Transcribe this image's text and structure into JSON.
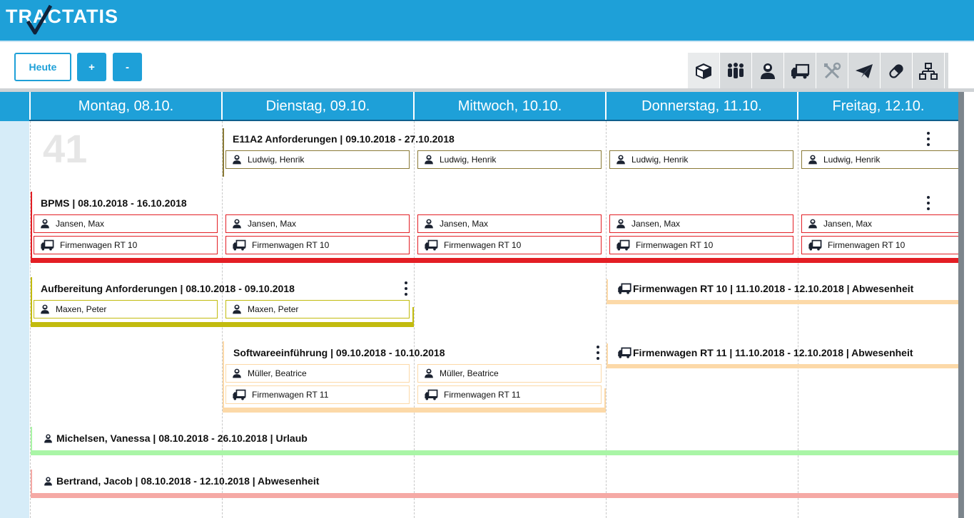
{
  "app": {
    "brand": "TRACTATIS"
  },
  "toolbar": {
    "today_label": "Heute",
    "zoom_in_label": "+",
    "zoom_out_label": "-"
  },
  "filter_icons": [
    "package-icon",
    "team-icon",
    "person-icon",
    "truck-icon",
    "tools-icon",
    "paper-plane-icon",
    "pill-icon",
    "hierarchy-icon"
  ],
  "calendar": {
    "week_number": "41",
    "days": [
      "Montag, 08.10.",
      "Dienstag, 09.10.",
      "Mittwoch, 10.10.",
      "Donnerstag, 11.10.",
      "Freitag, 12.10."
    ]
  },
  "events": {
    "e11a2": {
      "title": "E11A2 Anforderungen  | 09.10.2018 - 27.10.2018",
      "person": "Ludwig, Henrik",
      "color": "#8a7a36"
    },
    "bpms": {
      "title": "BPMS | 08.10.2018 - 16.10.2018",
      "person": "Jansen, Max",
      "vehicle": "Firmenwagen RT 10",
      "color": "#e31e24"
    },
    "aufbereitung": {
      "title": "Aufbereitung Anforderungen | 08.10.2018 - 09.10.2018",
      "person": "Maxen, Peter",
      "color": "#c2bb0e"
    },
    "software": {
      "title": "Softwareeinführung | 09.10.2018 - 10.10.2018",
      "person": "Müller, Beatrice",
      "vehicle": "Firmenwagen RT 11",
      "color": "#fcd9a8"
    },
    "rt10_absence": {
      "title": "Firmenwagen RT 10 | 11.10.2018 - 12.10.2018 | Abwesenheit",
      "color": "#fcd9a8"
    },
    "rt11_absence": {
      "title": "Firmenwagen RT 11 | 11.10.2018 - 12.10.2018 | Abwesenheit",
      "color": "#fcd9a8"
    },
    "michelsen": {
      "title": "Michelsen, Vanessa | 08.10.2018 - 26.10.2018 | Urlaub",
      "color": "#a9f5a6"
    },
    "bertrand": {
      "title": "Bertrand, Jacob | 08.10.2018 - 12.10.2018 | Abwesenheit",
      "color": "#f5a9a5"
    }
  }
}
